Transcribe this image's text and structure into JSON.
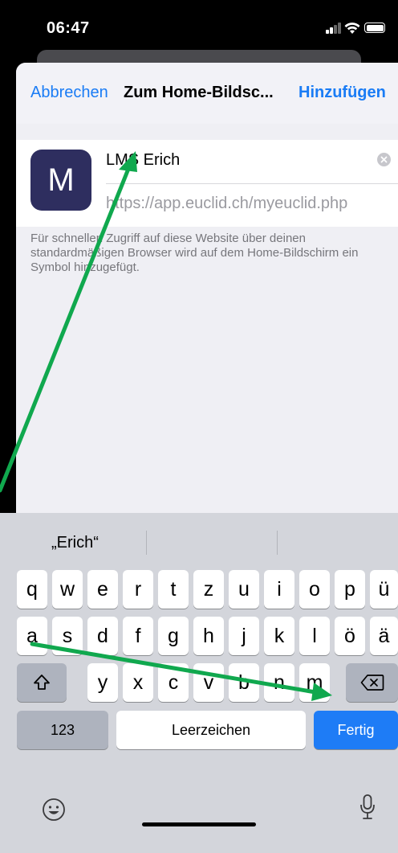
{
  "status": {
    "time": "06:47"
  },
  "nav": {
    "cancel": "Abbrechen",
    "title": "Zum Home-Bildsc...",
    "add": "Hinzufügen"
  },
  "card": {
    "icon_letter": "M",
    "name_value": "LMS Erich",
    "url": "https://app.euclid.ch/myeuclid.php"
  },
  "description": "Für schnellen Zugriff auf diese Website über deinen standardmäßigen Browser wird auf dem Home-Bildschirm ein Symbol hinzugefügt.",
  "keyboard": {
    "suggestion": "„Erich“",
    "row1": [
      "q",
      "w",
      "e",
      "r",
      "t",
      "z",
      "u",
      "i",
      "o",
      "p",
      "ü"
    ],
    "row2": [
      "a",
      "s",
      "d",
      "f",
      "g",
      "h",
      "j",
      "k",
      "l",
      "ö",
      "ä"
    ],
    "row3": [
      "y",
      "x",
      "c",
      "v",
      "b",
      "n",
      "m"
    ],
    "numbers_key": "123",
    "space_key": "Leerzeichen",
    "done_key": "Fertig",
    "shift_icon": "shift-icon",
    "delete_icon": "delete-icon",
    "emoji_icon": "emoji-icon",
    "mic_icon": "microphone-icon"
  },
  "colors": {
    "accent": "#1a7cf5",
    "app_icon_bg": "#2e2e5f",
    "annotation_arrow": "#10a84e",
    "done_key_bg": "#1e7cf6"
  }
}
